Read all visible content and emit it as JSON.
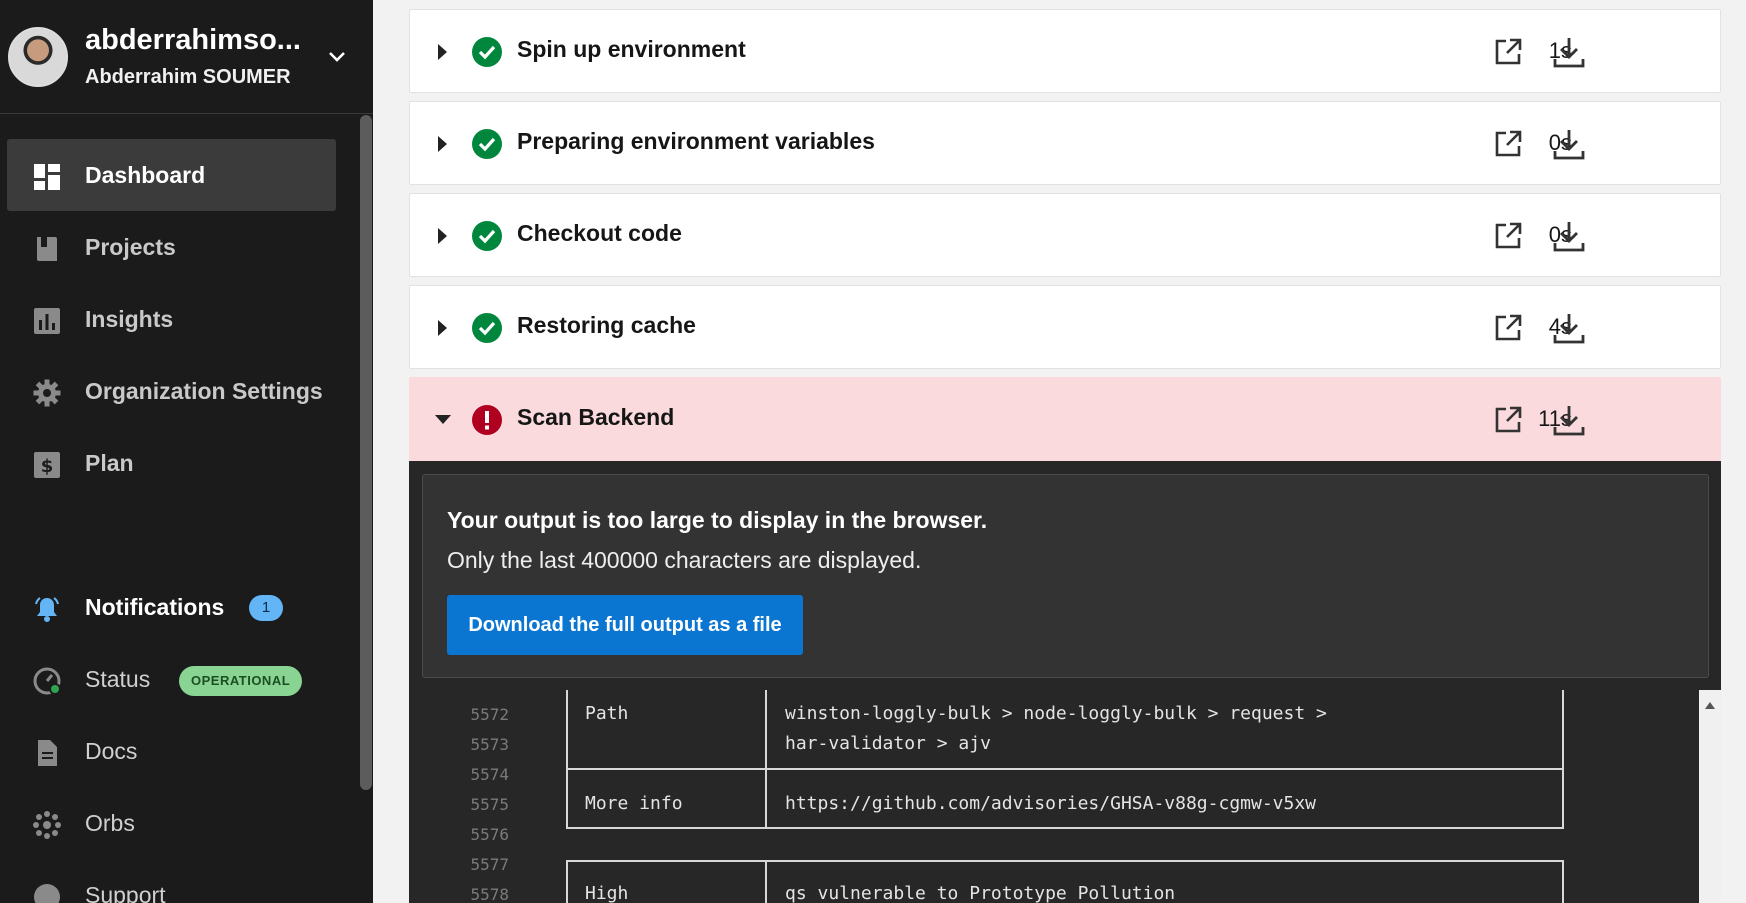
{
  "user": {
    "handle": "abderrahimso...",
    "full_name": "Abderrahim SOUMER"
  },
  "nav": {
    "dashboard": "Dashboard",
    "projects": "Projects",
    "insights": "Insights",
    "org_settings": "Organization Settings",
    "plan": "Plan",
    "notifications": "Notifications",
    "notifications_count": "1",
    "status": "Status",
    "status_badge": "OPERATIONAL",
    "docs": "Docs",
    "orbs": "Orbs",
    "support": "Support"
  },
  "steps": [
    {
      "title": "Spin up environment",
      "duration": "1s",
      "status": "success"
    },
    {
      "title": "Preparing environment variables",
      "duration": "0s",
      "status": "success"
    },
    {
      "title": "Checkout code",
      "duration": "0s",
      "status": "success"
    },
    {
      "title": "Restoring cache",
      "duration": "4s",
      "status": "success"
    },
    {
      "title": "Scan Backend",
      "duration": "11s",
      "status": "failed"
    }
  ],
  "output": {
    "notice_title": "Your output is too large to display in the browser.",
    "notice_text": "Only the last 400000 characters are displayed.",
    "download_button": "Download the full output as a file"
  },
  "log": {
    "lines": [
      {
        "num": "5572",
        "label": "Path",
        "value": "winston-loggly-bulk > node-loggly-bulk > request >"
      },
      {
        "num": "5573",
        "label": "",
        "value": "har-validator > ajv"
      },
      {
        "num": "5574",
        "label": "",
        "value": ""
      },
      {
        "num": "5575",
        "label": "More info",
        "value": "https://github.com/advisories/GHSA-v88g-cgmw-v5xw"
      },
      {
        "num": "5576",
        "label": "",
        "value": ""
      },
      {
        "num": "5577",
        "label": "",
        "value": ""
      },
      {
        "num": "5578",
        "label": "High",
        "value": "qs vulnerable to Prototype Pollution"
      }
    ]
  },
  "colors": {
    "success": "#00873d",
    "failed": "#b00020",
    "accent": "#0b76d2",
    "sidebar_bg": "#1b1b1b"
  }
}
